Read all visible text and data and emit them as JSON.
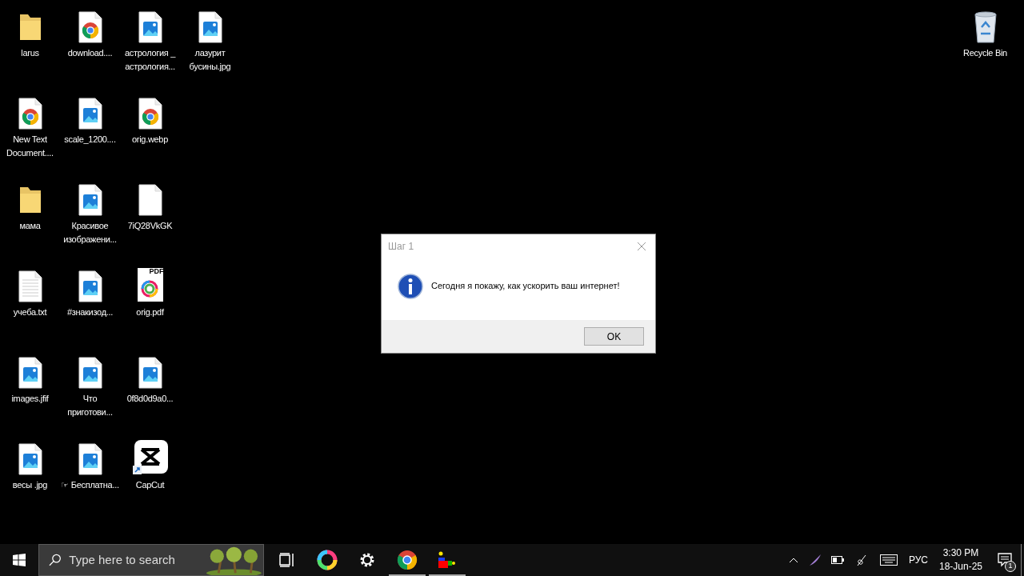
{
  "desktop": {
    "columns": [
      [
        {
          "kind": "folder",
          "label": "larus"
        },
        {
          "kind": "chrome-file",
          "label": "New Text Document...."
        },
        {
          "kind": "folder",
          "label": "мама"
        },
        {
          "kind": "text-file",
          "label": "учеба.txt"
        },
        {
          "kind": "image-file",
          "label": "images.jfif"
        },
        {
          "kind": "image-file",
          "label": "весы .jpg"
        }
      ],
      [
        {
          "kind": "chrome-file",
          "label": "download...."
        },
        {
          "kind": "image-file",
          "label": "scale_1200...."
        },
        {
          "kind": "image-file",
          "label": "Красивое изображени..."
        },
        {
          "kind": "image-file",
          "label": "#знакизод..."
        },
        {
          "kind": "image-file",
          "label": "Что приготови..."
        },
        {
          "kind": "image-file",
          "label": "☞ Бесплатна..."
        }
      ],
      [
        {
          "kind": "image-file",
          "label": "астрология _ астрология..."
        },
        {
          "kind": "chrome-file",
          "label": "orig.webp"
        },
        {
          "kind": "blank-file",
          "label": "7iQ28VkGK"
        },
        {
          "kind": "pdf-file",
          "label": "orig.pdf",
          "badge": "PDF"
        },
        {
          "kind": "image-file",
          "label": "0f8d0d9a0..."
        },
        {
          "kind": "capcut-shortcut",
          "label": "CapCut"
        }
      ],
      [
        {
          "kind": "image-file",
          "label": "лазурит бусины.jpg"
        }
      ]
    ],
    "right_icons": [
      {
        "kind": "recycle-bin",
        "label": "Recycle Bin"
      }
    ]
  },
  "dialog": {
    "title": "Шаг 1",
    "message": "Сегодня я покажу, как ускорить ваш интернет!",
    "buttons": [
      "OK"
    ]
  },
  "taskbar": {
    "search": {
      "placeholder": "Type here to search"
    },
    "apps": [
      {
        "kind": "task-view",
        "running": false
      },
      {
        "kind": "color-wheel",
        "running": false
      },
      {
        "kind": "settings",
        "running": false
      },
      {
        "kind": "chrome",
        "running": true
      },
      {
        "kind": "blocks",
        "running": true
      }
    ],
    "tray": {
      "language": "РУС",
      "time": "3:30 PM",
      "date": "18-Jun-25",
      "notifications": "1"
    }
  }
}
